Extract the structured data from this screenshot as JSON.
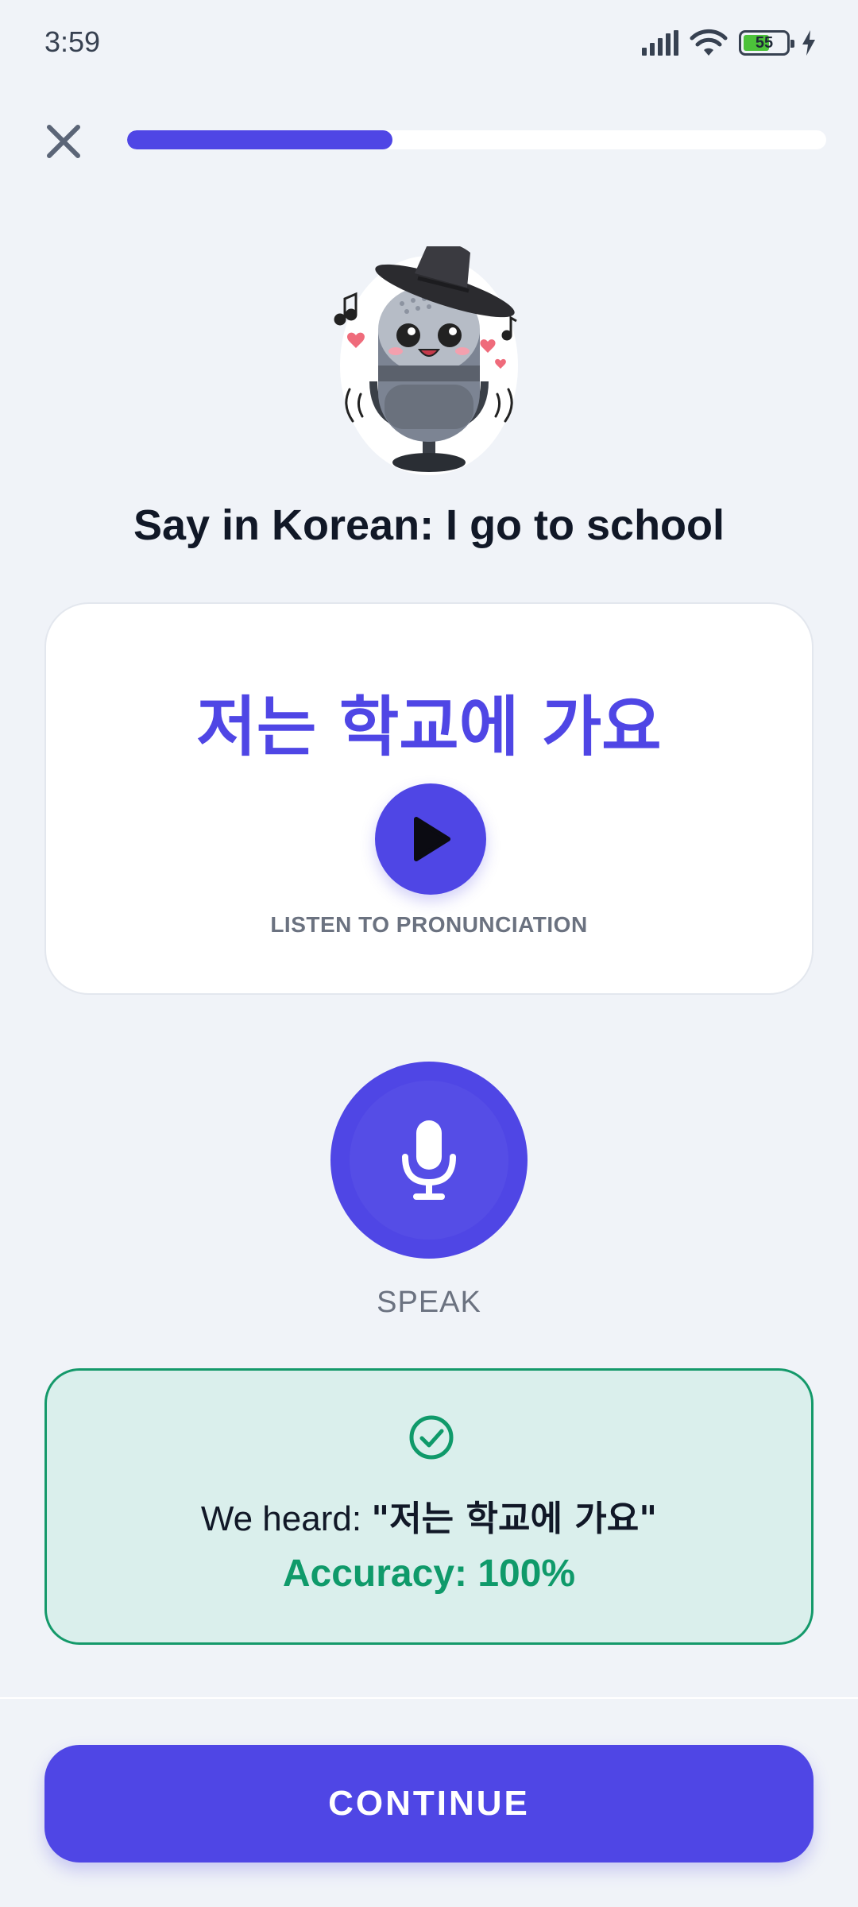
{
  "status_bar": {
    "time": "3:59",
    "battery_level": "55",
    "icons": [
      "signal-icon",
      "wifi-icon",
      "battery-icon",
      "charging-icon"
    ]
  },
  "header": {
    "close_icon": "close-icon",
    "progress_fraction": 0.38
  },
  "lesson": {
    "prompt": "Say in Korean: I go to school",
    "phrase": "저는 학교에 가요",
    "listen_label": "LISTEN TO PRONUNCIATION",
    "play_icon": "play-icon"
  },
  "speak": {
    "label": "SPEAK",
    "icon": "microphone-icon"
  },
  "result": {
    "icon": "check-circle-icon",
    "heard_prefix": "We heard: ",
    "heard_value": "\"저는 학교에 가요\"",
    "accuracy": "Accuracy: 100%"
  },
  "footer": {
    "continue_label": "CONTINUE"
  },
  "colors": {
    "accent": "#4f46e5",
    "background": "#f0f3f8",
    "success": "#0f9a6a",
    "success_bg": "#daefec"
  }
}
